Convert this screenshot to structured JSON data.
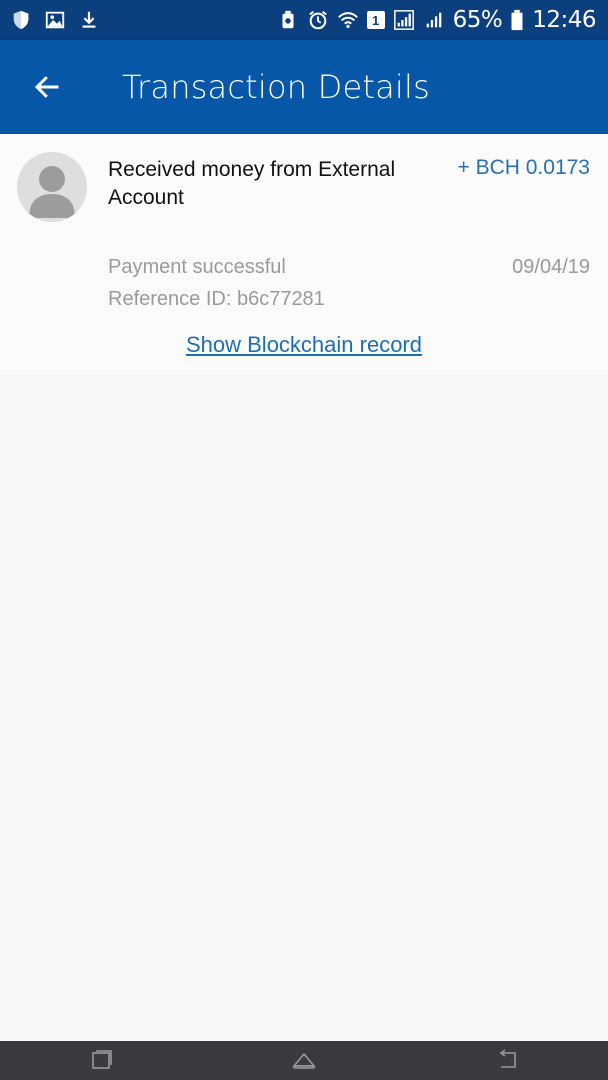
{
  "status_bar": {
    "left_icons": [
      "shield-icon",
      "image-icon",
      "download-icon"
    ],
    "right_icons": [
      "recycle-icon",
      "alarm-icon",
      "wifi-icon",
      "sim-1-icon",
      "signal-icon",
      "signal-icon-2",
      "battery-icon"
    ],
    "sim_badge": "1",
    "battery_percent": "65%",
    "time": "12:46"
  },
  "app_bar": {
    "title": "Transaction Details",
    "back_icon": "back-arrow-icon"
  },
  "transaction": {
    "title": "Received money from External Account",
    "amount": "+ BCH 0.0173",
    "status": "Payment successful",
    "date": "09/04/19",
    "reference": "Reference ID: b6c77281",
    "link_label": "Show Blockchain record"
  },
  "nav_bar": {
    "recents_icon": "recents-icon",
    "home_icon": "home-icon",
    "back_icon": "nav-back-icon"
  },
  "colors": {
    "status_bar": "#0b3f7d",
    "app_bar": "#0657a8",
    "amount": "#2a6fb0",
    "link": "#1e6fb2",
    "nav_bar": "#3a3b3f"
  }
}
